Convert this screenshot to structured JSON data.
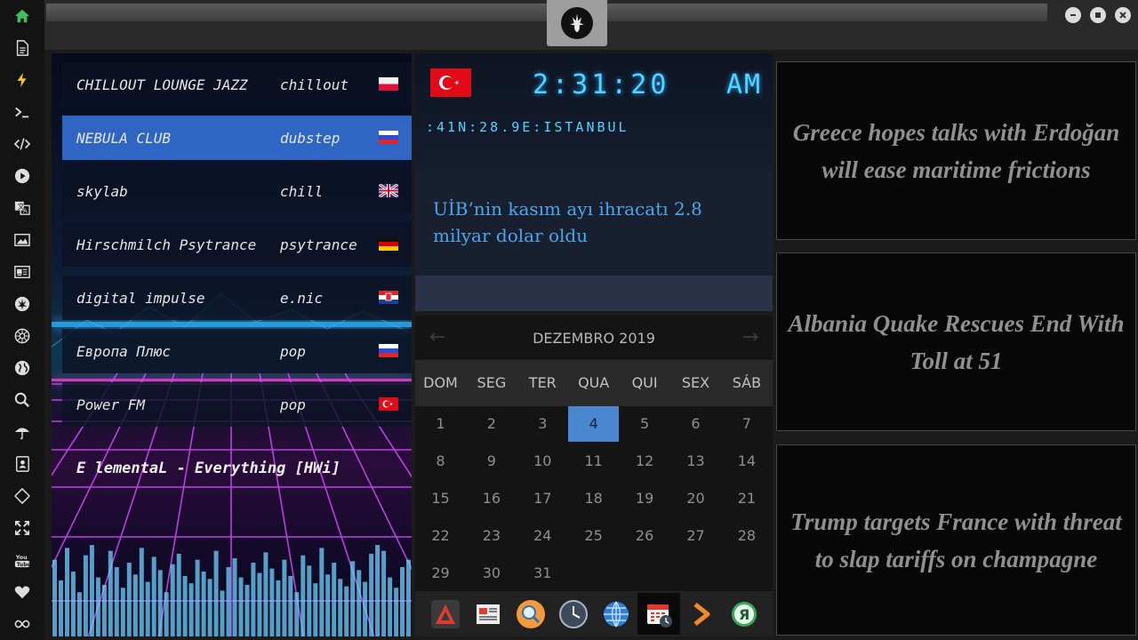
{
  "rail": {
    "icons": [
      "home-icon",
      "document-icon",
      "lightning-icon",
      "terminal-icon",
      "code-icon",
      "play-icon",
      "translate-icon",
      "image-icon",
      "news-icon",
      "rebel-alliance-icon",
      "empire-icon",
      "globe-icon",
      "search-icon",
      "umbrella-icon",
      "contacts-icon",
      "transfer-icon",
      "expand-icon",
      "youtube-icon",
      "heart-icon",
      "infinity-icon"
    ]
  },
  "radio": {
    "stations": [
      {
        "name": "CHILLOUT LOUNGE JAZZ",
        "genre": "chillout",
        "flag": "poland"
      },
      {
        "name": "NEBULA CLUB",
        "genre": "dubstep",
        "flag": "russia",
        "active": true
      },
      {
        "name": "skylab",
        "genre": "chill",
        "flag": "uk"
      },
      {
        "name": "Hirschmilch Psytrance",
        "genre": "psytrance",
        "flag": "germany"
      },
      {
        "name": "digital impulse",
        "genre": "e.nic",
        "flag": "croatia"
      },
      {
        "name": "Европа Плюс",
        "genre": "pop",
        "flag": "russia"
      },
      {
        "name": "Power FM",
        "genre": "pop",
        "flag": "turkey"
      }
    ],
    "now_playing": "E lementaL - Everything [HWi]",
    "equalizer_levels": [
      0.52,
      0.38,
      0.6,
      0.44,
      0.3,
      0.55,
      0.62,
      0.4,
      0.35,
      0.58,
      0.47,
      0.33,
      0.5,
      0.42,
      0.6,
      0.37,
      0.54,
      0.45,
      0.3,
      0.49,
      0.56,
      0.41,
      0.36,
      0.52,
      0.44,
      0.39,
      0.58,
      0.31,
      0.47,
      0.53,
      0.4,
      0.35,
      0.5,
      0.43,
      0.57,
      0.46,
      0.38,
      0.52,
      0.41,
      0.3,
      0.55,
      0.48,
      0.36,
      0.6,
      0.42,
      0.5,
      0.39,
      0.34,
      0.51,
      0.45,
      0.37,
      0.56,
      0.62,
      0.58,
      0.4,
      0.33,
      0.47,
      0.52
    ]
  },
  "clock": {
    "time": "2:31:20",
    "ampm": "AM",
    "location": ":41N:28.9E:ISTANBUL",
    "flag": "turkey"
  },
  "local_news": {
    "headline": "UİB’nin kasım ayı ihracatı 2.8 milyar dolar oldu"
  },
  "calendar": {
    "month_label": "DEZEMBRO 2019",
    "prev_arrow": "←",
    "next_arrow": "→",
    "day_names": [
      "DOM",
      "SEG",
      "TER",
      "QUA",
      "QUI",
      "SEX",
      "SÁB"
    ],
    "weeks": [
      [
        "1",
        "2",
        "3",
        "4",
        "5",
        "6",
        "7"
      ],
      [
        "8",
        "9",
        "10",
        "11",
        "12",
        "13",
        "14"
      ],
      [
        "15",
        "16",
        "17",
        "18",
        "19",
        "20",
        "21"
      ],
      [
        "22",
        "23",
        "24",
        "25",
        "26",
        "27",
        "28"
      ],
      [
        "29",
        "30",
        "31"
      ]
    ],
    "today": "4"
  },
  "dock": {
    "apps": [
      "launcher-icon",
      "newspaper-icon",
      "search-app-icon",
      "clock-app-icon",
      "browser-globe-icon",
      "calendar-app-icon",
      "forward-arrow-icon",
      "yandex-icon"
    ],
    "active_index": 5
  },
  "headlines": [
    "Greece hopes talks with Erdoğan will ease maritime frictions",
    "Albania Quake Rescues End With Toll at 51",
    "Trump targets France with threat to slap tariffs on champagne"
  ],
  "colors": {
    "accent_blue": "#2f66c4",
    "clock_cyan": "#4fd5ff",
    "calendar_today": "#4a86cf",
    "news_link_blue": "#4aa8ea"
  }
}
